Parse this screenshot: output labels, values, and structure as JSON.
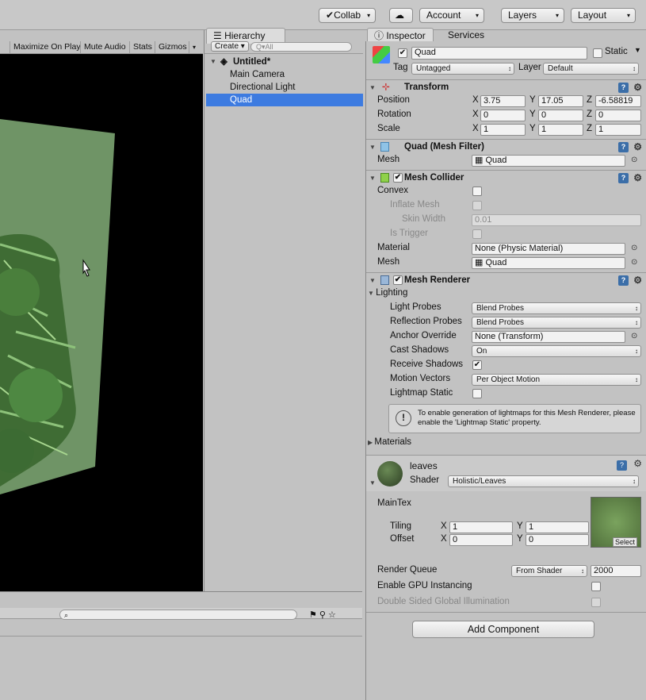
{
  "toolbar": {
    "collab": "Collab",
    "account": "Account",
    "layers": "Layers",
    "layout": "Layout"
  },
  "game": {
    "buttons": [
      "Maximize On Play",
      "Mute Audio",
      "Stats",
      "Gizmos"
    ]
  },
  "hierarchy": {
    "tab": "Hierarchy",
    "create": "Create",
    "search_placeholder": "Q▾All",
    "scene": "Untitled*",
    "items": [
      "Main Camera",
      "Directional Light",
      "Quad"
    ]
  },
  "inspector": {
    "tab": "Inspector",
    "services_tab": "Services",
    "object": {
      "name": "Quad",
      "static_label": "Static",
      "tag_label": "Tag",
      "tag": "Untagged",
      "layer_label": "Layer",
      "layer": "Default"
    },
    "transform": {
      "title": "Transform",
      "position_label": "Position",
      "rotation_label": "Rotation",
      "scale_label": "Scale",
      "position": [
        "3.75",
        "17.05",
        "-6.58819"
      ],
      "rotation": [
        "0",
        "0",
        "0"
      ],
      "scale": [
        "1",
        "1",
        "1"
      ],
      "axes": [
        "X",
        "Y",
        "Z"
      ]
    },
    "mesh_filter": {
      "title": "Quad (Mesh Filter)",
      "mesh_label": "Mesh",
      "mesh": "Quad"
    },
    "mesh_collider": {
      "title": "Mesh Collider",
      "convex": "Convex",
      "inflate": "Inflate Mesh",
      "skin": "Skin Width",
      "skin_value": "0.01",
      "trigger": "Is Trigger",
      "material_label": "Material",
      "material": "None (Physic Material)",
      "mesh_label": "Mesh",
      "mesh": "Quad"
    },
    "mesh_renderer": {
      "title": "Mesh Renderer",
      "lighting": "Lighting",
      "light_probes": "Light Probes",
      "light_probes_value": "Blend Probes",
      "reflection_probes": "Reflection Probes",
      "reflection_probes_value": "Blend Probes",
      "anchor": "Anchor Override",
      "anchor_value": "None (Transform)",
      "cast": "Cast Shadows",
      "cast_value": "On",
      "receive": "Receive Shadows",
      "motion": "Motion Vectors",
      "motion_value": "Per Object Motion",
      "lightmap": "Lightmap Static",
      "info": "To enable generation of lightmaps for this Mesh Renderer, please enable the 'Lightmap Static' property.",
      "materials": "Materials"
    },
    "material": {
      "name": "leaves",
      "shader_label": "Shader",
      "shader": "Holistic/Leaves",
      "maintex": "MainTex",
      "tiling": "Tiling",
      "offset": "Offset",
      "tiling_values": [
        "1",
        "1"
      ],
      "offset_values": [
        "0",
        "0"
      ],
      "select": "Select",
      "render_queue": "Render Queue",
      "render_queue_mode": "From Shader",
      "render_queue_value": "2000",
      "gpu": "Enable GPU Instancing",
      "dsgi": "Double Sided Global Illumination"
    },
    "add_component": "Add Component"
  }
}
